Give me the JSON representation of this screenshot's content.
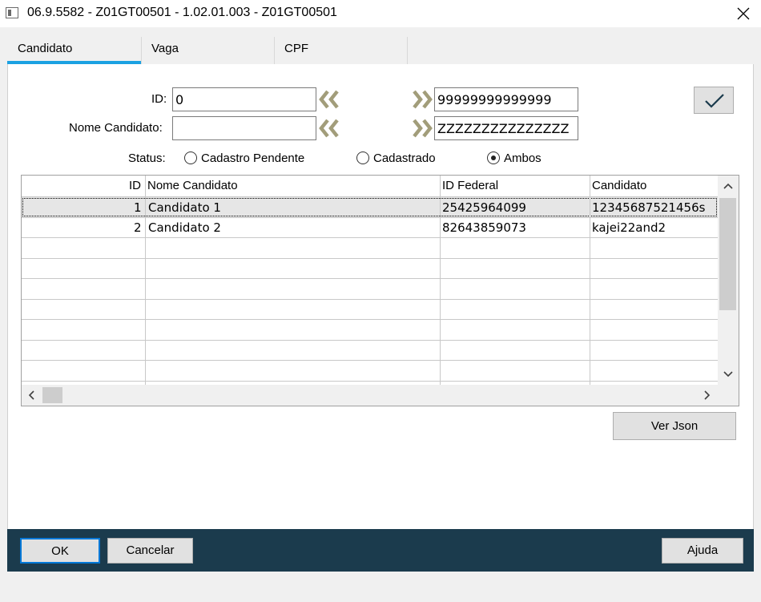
{
  "window": {
    "title": "06.9.5582 - Z01GT00501 - 1.02.01.003 - Z01GT00501"
  },
  "tabs": [
    {
      "label": "Candidato",
      "active": true
    },
    {
      "label": "Vaga",
      "active": false
    },
    {
      "label": "CPF",
      "active": false
    }
  ],
  "filters": {
    "id_label": "ID:",
    "id_from": "0",
    "id_to": "99999999999999",
    "nome_label": "Nome Candidato:",
    "nome_from": "",
    "nome_to": "ZZZZZZZZZZZZZZZ"
  },
  "status": {
    "label": "Status:",
    "options": [
      {
        "label": "Cadastro Pendente",
        "selected": false
      },
      {
        "label": "Cadastrado",
        "selected": false
      },
      {
        "label": "Ambos",
        "selected": true
      }
    ]
  },
  "grid": {
    "columns": [
      "ID",
      "Nome Candidato",
      "ID Federal",
      "Candidato"
    ],
    "rows": [
      {
        "id": "1",
        "nome": "Candidato 1",
        "id_federal": "25425964099",
        "candidato": "12345687521456s",
        "selected": true
      },
      {
        "id": "2",
        "nome": "Candidato 2",
        "id_federal": "82643859073",
        "candidato": "kajei22and2",
        "selected": false
      }
    ]
  },
  "buttons": {
    "ver_json": "Ver Json",
    "ok": "OK",
    "cancelar": "Cancelar",
    "ajuda": "Ajuda"
  },
  "colors": {
    "accent": "#1ba1e2",
    "footer": "#1b3b4d",
    "arrow": "#a29d7a"
  }
}
